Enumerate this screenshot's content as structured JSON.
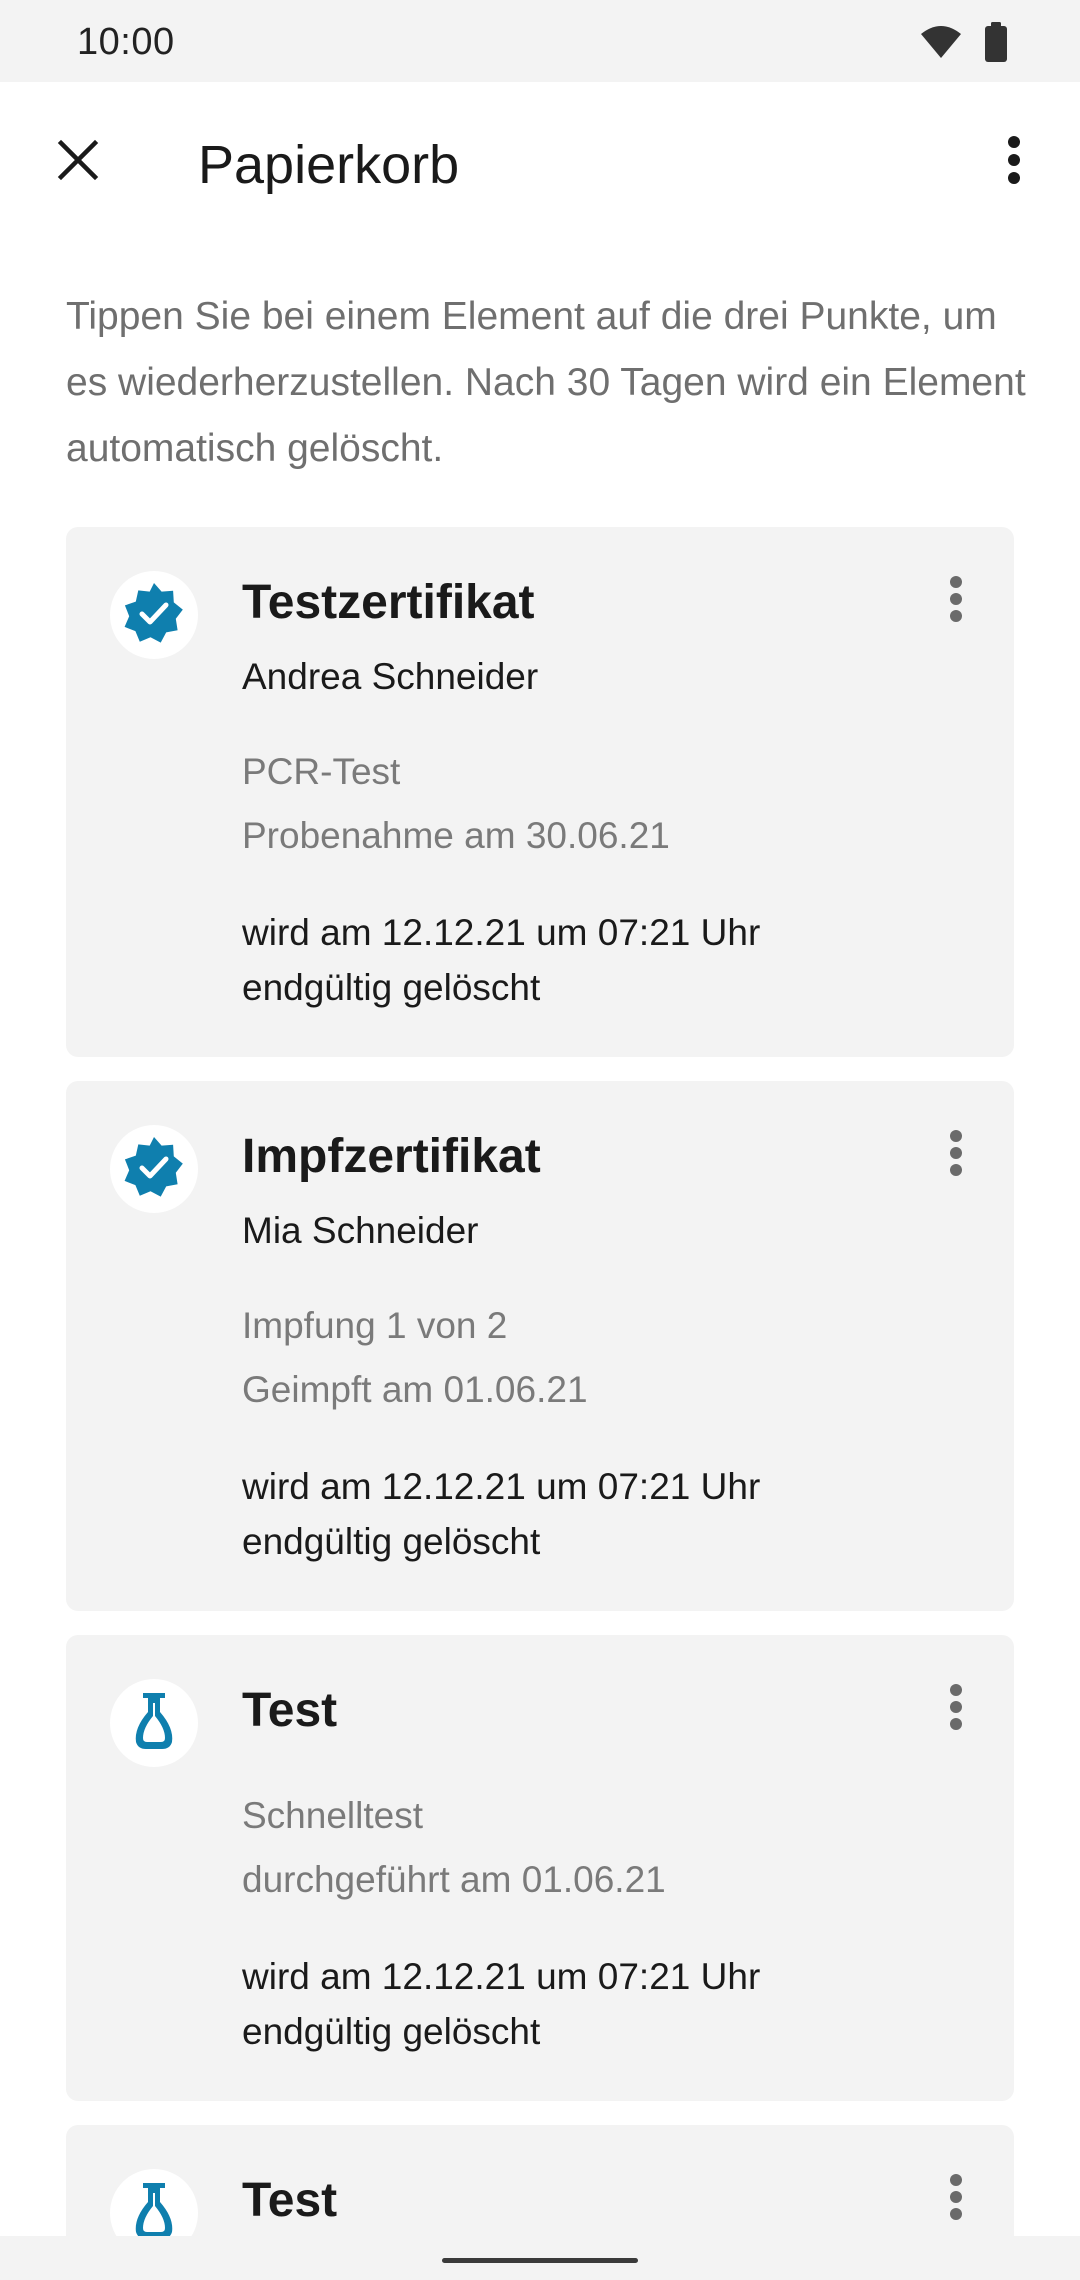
{
  "status_bar": {
    "time": "10:00",
    "icons": [
      "wifi-icon",
      "battery-icon"
    ]
  },
  "app_bar": {
    "title": "Papierkorb",
    "close_icon": "close-icon",
    "overflow_icon": "more-vert-icon"
  },
  "intro": {
    "text": "Tippen Sie bei einem Element auf die drei Punkte, um es wiederherzustellen. Nach 30 Tagen wird ein Element automatisch gelöscht."
  },
  "colors": {
    "accent": "#0f7fae",
    "card_background": "#f3f3f3",
    "secondary_text": "#7a7a7a"
  },
  "cards": [
    {
      "icon": "verified-badge-icon",
      "title": "Testzertifikat",
      "name": "Andrea Schneider",
      "line1": "PCR-Test",
      "line2": "Probenahme am 30.06.21",
      "deletion_line1": "wird am 12.12.21 um 07:21 Uhr",
      "deletion_line2": "endgültig gelöscht"
    },
    {
      "icon": "verified-badge-icon",
      "title": "Impfzertifikat",
      "name": "Mia Schneider",
      "line1": "Impfung 1 von 2",
      "line2": "Geimpft am 01.06.21",
      "deletion_line1": "wird am 12.12.21 um 07:21 Uhr",
      "deletion_line2": "endgültig gelöscht"
    },
    {
      "icon": "flask-icon",
      "title": "Test",
      "line1": "Schnelltest",
      "line2": "durchgeführt am 01.06.21",
      "deletion_line1": "wird am 12.12.21 um 07:21 Uhr",
      "deletion_line2": "endgültig gelöscht"
    },
    {
      "icon": "flask-icon",
      "title": "Test"
    }
  ]
}
